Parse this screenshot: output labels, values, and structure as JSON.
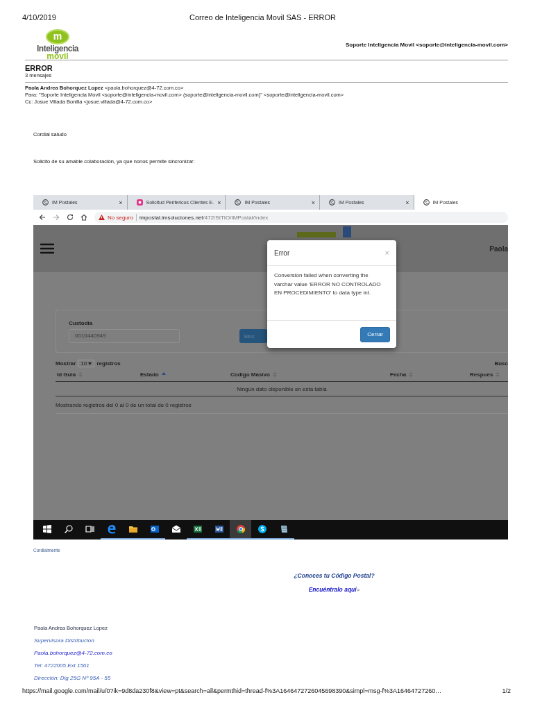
{
  "print_header": {
    "date": "4/10/2019",
    "title": "Correo de Inteligencia Movil SAS - ERROR"
  },
  "logo": {
    "mark": "m",
    "line1": "Inteligencia",
    "line2": "movil"
  },
  "account": "Soporte Inteligencia Movil <soporte@inteligencia-movil.com>",
  "thread": {
    "subject": "ERROR",
    "count": "3 mensajes"
  },
  "message": {
    "from_name": "Paola Andrea Bohorquez Lopez",
    "from_email": "<paola.bohorquez@4-72.com.co>",
    "to": "Para: \"Soporte Inteligencia Movil <soporte@inteligencia-movil.com> (soporte@inteligencia-movil.com)\" <soporte@inteligencia-movil.com>",
    "cc": "Cc: Josue Villada Bonilla <josue.villada@4-72.com.co>",
    "paragraphs": [
      "Cordial saludo",
      "Solicito de su amable colaboración, ya que nonos permite sincronizar:"
    ]
  },
  "screenshot": {
    "tabs": [
      {
        "title": "IM Postales",
        "kind": "globe",
        "selected": false,
        "close": "×"
      },
      {
        "title": "Solicitud Perifericos Clientes E-",
        "kind": "app",
        "selected": false,
        "close": "×"
      },
      {
        "title": "IM Postales",
        "kind": "globe",
        "selected": false,
        "close": "×"
      },
      {
        "title": "IM Postales",
        "kind": "globe",
        "selected": false,
        "close": "×"
      },
      {
        "title": "IM Postales",
        "kind": "globe",
        "selected": true
      }
    ],
    "address": {
      "warning": "No seguro",
      "host": "impostal.imsoluciones.net",
      "path": "/472/SITIO/IMPostal/Index"
    },
    "user": "Paola",
    "custodia": {
      "label": "Custodia",
      "value": "0010440949",
      "button": "Sinc"
    },
    "table": {
      "show_label": "Mostrar",
      "page_size": "10",
      "records_label": "registros",
      "search": "Busc",
      "columns": [
        {
          "label": "Id Guia",
          "sorted": false
        },
        {
          "label": "Estado",
          "sorted": true
        },
        {
          "label": "Codigo Masivo",
          "sorted": false
        },
        {
          "label": "Fecha",
          "sorted": false
        },
        {
          "label": "Respues",
          "sorted": false
        }
      ],
      "empty": "Ningún dato disponible en esta tabla",
      "info": "Mostrando registros del 0 al 0 de un total de 0 registros"
    },
    "modal": {
      "title": "Error",
      "close": "×",
      "message": "Conversion failed when converting the varchar value 'ERROR NO CONTROLADO EN PROCEDIMIENTO' to data type int.",
      "button": "Cerrar"
    },
    "taskbar": [
      {
        "kind": "start",
        "running": false
      },
      {
        "kind": "search",
        "running": false
      },
      {
        "kind": "taskview",
        "running": false
      },
      {
        "kind": "edge",
        "running": true
      },
      {
        "kind": "folder",
        "running": true
      },
      {
        "kind": "outlook",
        "running": true
      },
      {
        "kind": "mail",
        "running": false
      },
      {
        "kind": "excel",
        "running": true
      },
      {
        "kind": "word",
        "running": true
      },
      {
        "kind": "chrome",
        "running": true
      },
      {
        "kind": "skype",
        "running": true
      },
      {
        "kind": "notepad",
        "running": true
      }
    ]
  },
  "closing": "Cordialmente",
  "promo": {
    "question": "¿Conoces tu Código Postal?",
    "link": "Encuéntralo aquí",
    "suffix": ">"
  },
  "signature": [
    {
      "text": "Paola Andrea Bohorquez Lopez",
      "kind": "name"
    },
    {
      "text": "Supervisora Distribucion",
      "kind": "italic"
    },
    {
      "text": "Paola.bohorquez@4-72.com.co",
      "kind": "email"
    },
    {
      "text": "Tel: 4722005 Ext 1561",
      "kind": "italic"
    },
    {
      "text": "Dirección: Dig 25G Nº 95A - 55",
      "kind": "italic"
    }
  ],
  "print_footer": {
    "url": "https://mail.google.com/mail/u/0?ik=9d8da230f8&view=pt&search=all&permthid=thread-f%3A1646472726045698390&simpl=msg-f%3A16464727260…",
    "page": "1/2"
  }
}
